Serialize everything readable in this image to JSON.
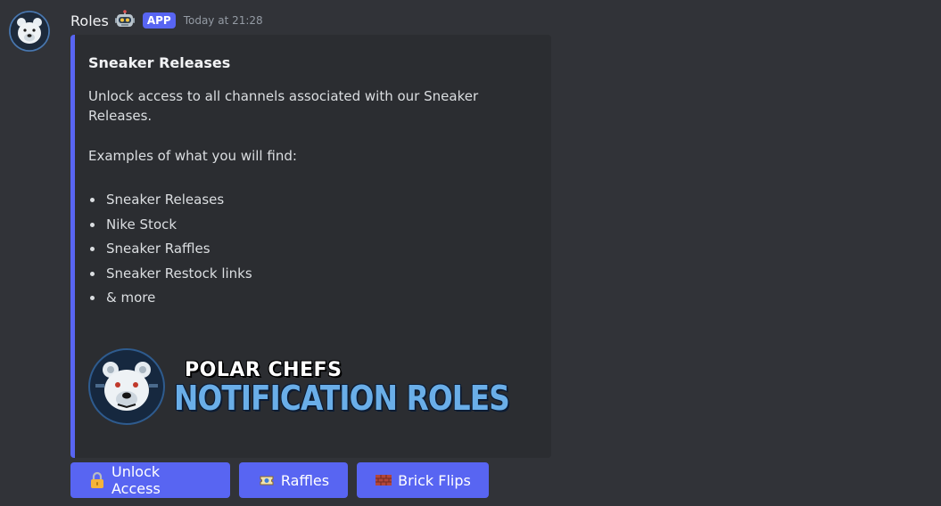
{
  "message": {
    "username": "Roles",
    "bot_icon": "robot-emoji-icon",
    "badge": "APP",
    "timestamp": "Today at 21:28",
    "avatar": "polar-bear-avatar"
  },
  "embed": {
    "accent_color": "#5865f2",
    "title": "Sneaker Releases",
    "description": "Unlock access to all channels associated with our Sneaker Releases.",
    "examples_intro": "Examples of what you will find:",
    "items": [
      "Sneaker Releases",
      "Nike Stock",
      "Sneaker Raffles",
      "Sneaker Restock links",
      "& more"
    ],
    "banner": {
      "line1": "POLAR CHEFS",
      "line2": "NOTIFICATION ROLES",
      "logo": "polar-bear-logo"
    }
  },
  "buttons": [
    {
      "label": "Unlock Access",
      "icon": "lock-icon"
    },
    {
      "label": "Raffles",
      "icon": "ticket-icon"
    },
    {
      "label": "Brick Flips",
      "icon": "brick-icon"
    }
  ],
  "colors": {
    "background": "#313338",
    "embed_background": "#2b2d31",
    "blurple": "#5865f2",
    "banner_blue": "#6aaee8"
  }
}
